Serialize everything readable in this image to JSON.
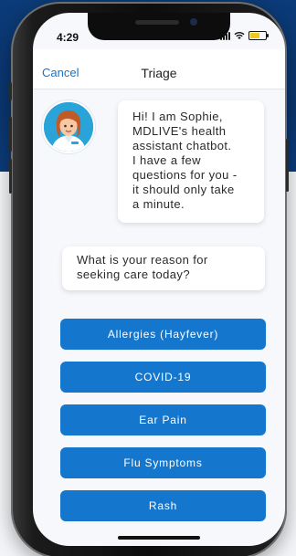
{
  "status_bar": {
    "time": "4:29"
  },
  "nav": {
    "cancel_label": "Cancel",
    "title": "Triage"
  },
  "chat": {
    "intro_lines": [
      "Hi! I am Sophie,",
      "MDLIVE's health",
      "assistant chatbot.",
      "I have a few",
      "questions for you -",
      "it should only take",
      "a minute."
    ],
    "question_lines": [
      "What is your reason for",
      "seeking care today?"
    ]
  },
  "options": [
    "Allergies (Hayfever)",
    "COVID-19",
    "Ear Pain",
    "Flu Symptoms",
    "Rash"
  ],
  "colors": {
    "primary": "#1576cd",
    "link": "#1a73c8",
    "background_top": "#0b3b78",
    "battery": "#f0c91a"
  },
  "icons": {
    "avatar": "doctor-avatar-icon",
    "signal": "signal-icon",
    "wifi": "wifi-icon",
    "battery": "battery-icon"
  }
}
